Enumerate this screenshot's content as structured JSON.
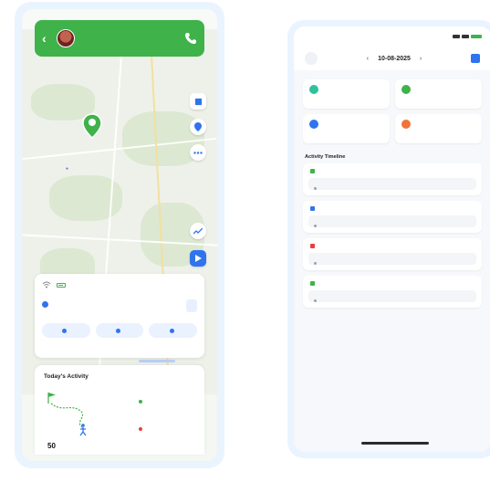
{
  "left": {
    "status": {
      "time": "",
      "center": "",
      "right": ""
    },
    "header": {
      "title": "",
      "subtitle": ""
    },
    "location_card": {
      "battery": "",
      "address": "",
      "actions": [
        "",
        "",
        ""
      ]
    },
    "activity": {
      "title": "Today's Activity",
      "events": [
        {
          "time": "",
          "text": ""
        },
        {
          "time": "",
          "text": ""
        }
      ],
      "steps_value": "50",
      "steps_unit": "",
      "footer_left": "",
      "footer_right": ""
    }
  },
  "right": {
    "status_time": "",
    "date": "10-08-2025",
    "stats": [
      {
        "value": "",
        "label": "",
        "color": "#2fc29a"
      },
      {
        "value": "",
        "label": "",
        "color": "#3fb24a"
      },
      {
        "value": "",
        "label": "",
        "color": "#2f74ee"
      },
      {
        "value": "",
        "label": "",
        "color": "#f0733a"
      }
    ],
    "timeline_title": "Activity Timeline",
    "events": [
      {
        "title": "",
        "time": "",
        "color": "#3fb24a",
        "heading": "",
        "detail": ""
      },
      {
        "title": "",
        "time": "",
        "color": "#2f74ee",
        "heading": "",
        "detail": ""
      },
      {
        "title": "",
        "time": "",
        "color": "#e84040",
        "heading": "",
        "detail": ""
      },
      {
        "title": "",
        "time": "",
        "color": "#3fb24a",
        "heading": "",
        "detail": ""
      }
    ]
  }
}
